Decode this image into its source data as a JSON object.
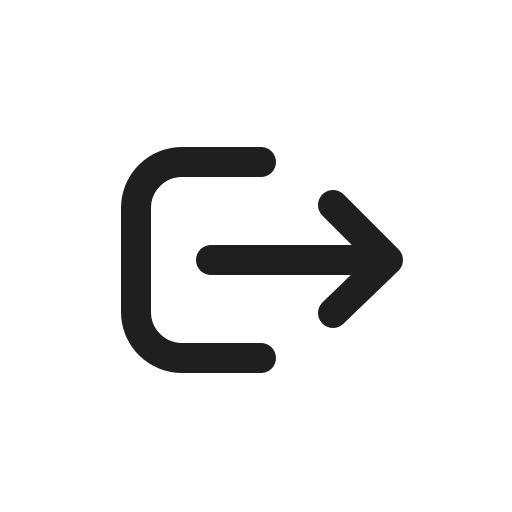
{
  "icon": {
    "name": "logout-icon",
    "stroke_color": "#1f1f1f",
    "background_color": "#ffffff"
  }
}
